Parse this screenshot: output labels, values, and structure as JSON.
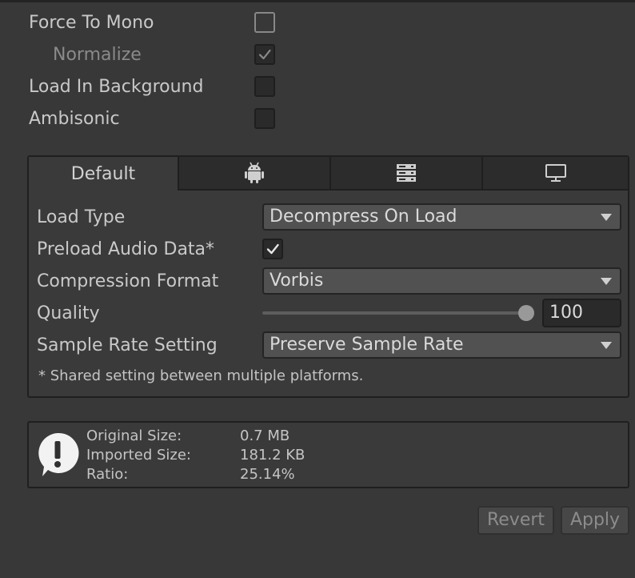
{
  "settings": {
    "force_to_mono": {
      "label": "Force To Mono",
      "checked": false
    },
    "normalize": {
      "label": "Normalize",
      "checked": true,
      "disabled": true
    },
    "load_in_background": {
      "label": "Load In Background",
      "checked": false
    },
    "ambisonic": {
      "label": "Ambisonic",
      "checked": false
    }
  },
  "platform_tabs": [
    {
      "label": "Default",
      "icon": null,
      "active": true
    },
    {
      "label": "",
      "icon": "android-icon",
      "active": false
    },
    {
      "label": "",
      "icon": "server-icon",
      "active": false
    },
    {
      "label": "",
      "icon": "monitor-icon",
      "active": false
    }
  ],
  "platform_settings": {
    "load_type": {
      "label": "Load Type",
      "value": "Decompress On Load"
    },
    "preload_audio_data": {
      "label": "Preload Audio Data*",
      "checked": true
    },
    "compression_format": {
      "label": "Compression Format",
      "value": "Vorbis"
    },
    "quality": {
      "label": "Quality",
      "value": "100",
      "slider_fraction": 1.0
    },
    "sample_rate_setting": {
      "label": "Sample Rate Setting",
      "value": "Preserve Sample Rate"
    },
    "note": "* Shared setting between multiple platforms."
  },
  "info": {
    "icon": "warning-icon",
    "rows": [
      {
        "label": "Original Size:",
        "value": "0.7 MB"
      },
      {
        "label": "Imported Size:",
        "value": "181.2 KB"
      },
      {
        "label": "Ratio:",
        "value": "25.14%"
      }
    ]
  },
  "buttons": {
    "revert": "Revert",
    "apply": "Apply"
  },
  "colors": {
    "background": "#383838",
    "checkmark": "#e6e6e6",
    "disabled_text": "#8a8a8a"
  }
}
